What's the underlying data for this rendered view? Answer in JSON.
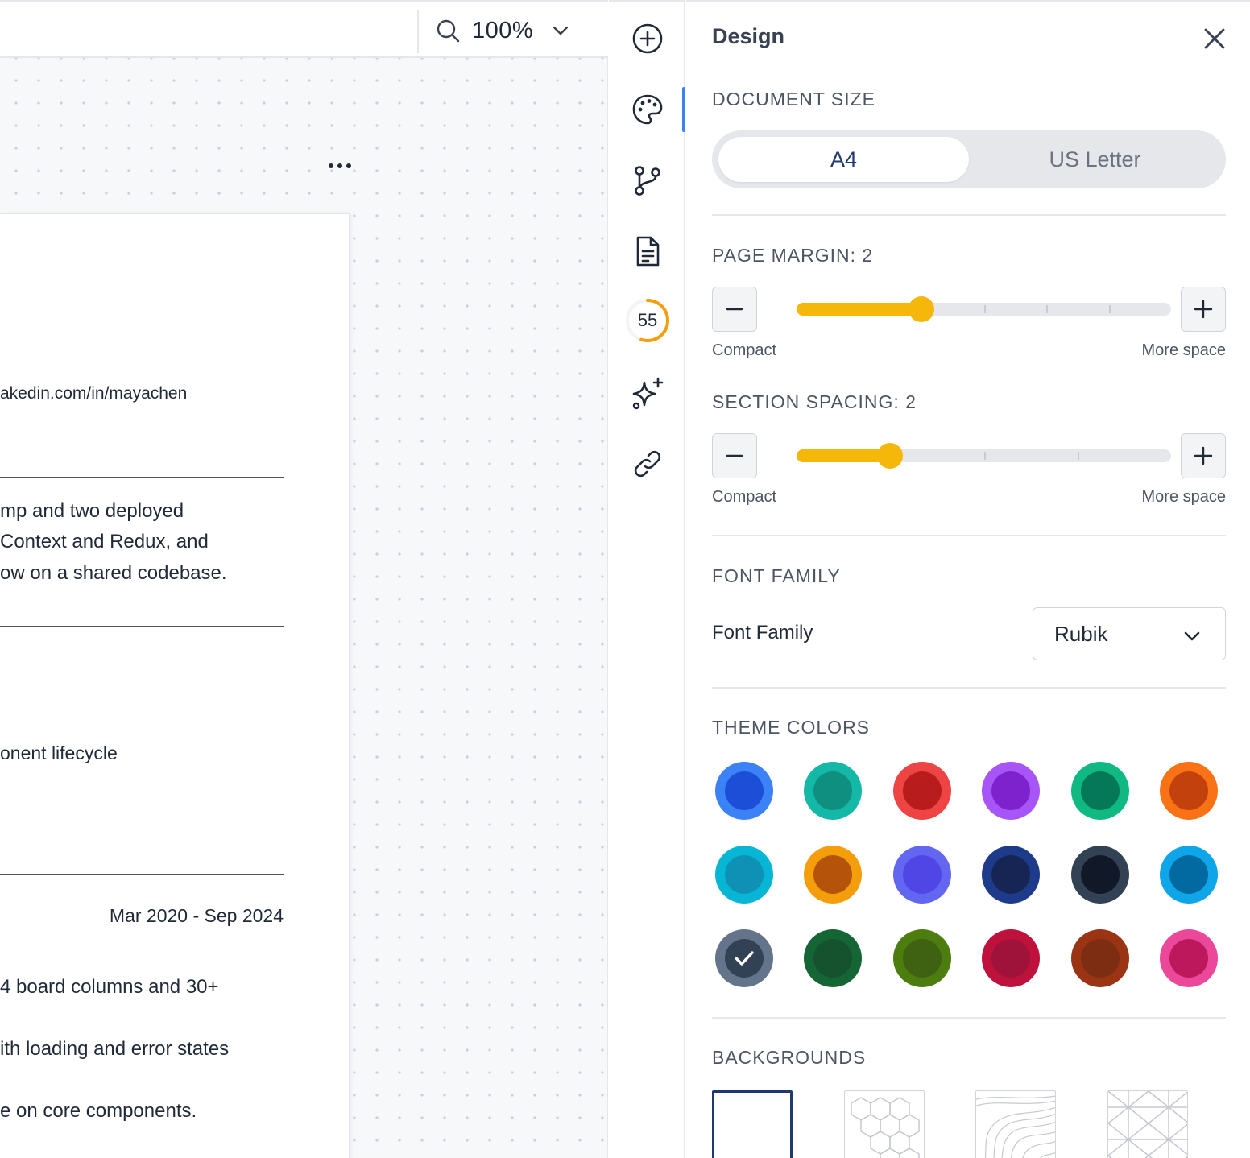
{
  "toolbar": {
    "zoom_value": "100%"
  },
  "document": {
    "linkedin_text": "akedin.com/in/mayachen",
    "summary_lines": [
      "mp and two deployed",
      "Context and Redux, and",
      "ow on a shared codebase."
    ],
    "skill_line": "onent lifecycle",
    "job_dates": "Mar 2020 - Sep 2024",
    "bullets": [
      "4 board columns and 30+",
      "ith loading and error states",
      "e on core components."
    ]
  },
  "rail": {
    "icons": [
      "plus-circle-icon",
      "palette-icon",
      "branch-icon",
      "document-icon",
      "score-icon",
      "sparkle-icon",
      "link-icon"
    ],
    "score": "55",
    "score_percent": 55,
    "score_color": "#f59e0b",
    "active_color": "#3b82f6"
  },
  "panel": {
    "title": "Design",
    "document_size": {
      "label": "DOCUMENT SIZE",
      "options": [
        "A4",
        "US Letter"
      ],
      "selected": "A4"
    },
    "page_margin": {
      "label": "PAGE MARGIN: 2",
      "value": 2,
      "min": 0,
      "max": 6,
      "min_hint": "Compact",
      "max_hint": "More space"
    },
    "section_spacing": {
      "label": "SECTION SPACING: 2",
      "value": 2,
      "min": 1,
      "max": 5,
      "min_hint": "Compact",
      "max_hint": "More space"
    },
    "font_family": {
      "section_label": "FONT FAMILY",
      "field_label": "Font Family",
      "value": "Rubik"
    },
    "theme_colors": {
      "label": "THEME COLORS",
      "selected_index": 12,
      "swatches": [
        {
          "outer": "#3b82f6",
          "inner": "#1d4ed8"
        },
        {
          "outer": "#14b8a6",
          "inner": "#0f8f7f"
        },
        {
          "outer": "#ef4444",
          "inner": "#b91c1c"
        },
        {
          "outer": "#a855f7",
          "inner": "#7e22ce"
        },
        {
          "outer": "#10b981",
          "inner": "#047857"
        },
        {
          "outer": "#f97316",
          "inner": "#c2410c"
        },
        {
          "outer": "#06b6d4",
          "inner": "#0e91b5"
        },
        {
          "outer": "#f59e0b",
          "inner": "#b45309"
        },
        {
          "outer": "#6366f1",
          "inner": "#4f46e5"
        },
        {
          "outer": "#1e3a8a",
          "inner": "#172554"
        },
        {
          "outer": "#334155",
          "inner": "#111827"
        },
        {
          "outer": "#0ea5e9",
          "inner": "#0369a1"
        },
        {
          "outer": "#64748b",
          "inner": "#334155"
        },
        {
          "outer": "#166534",
          "inner": "#14532d"
        },
        {
          "outer": "#4d7c0f",
          "inner": "#3f6212"
        },
        {
          "outer": "#be123c",
          "inner": "#9f1239"
        },
        {
          "outer": "#9a3412",
          "inner": "#7c2d12"
        },
        {
          "outer": "#ec4899",
          "inner": "#be185d"
        }
      ]
    },
    "backgrounds": {
      "label": "BACKGROUNDS",
      "options": [
        "blank",
        "hexagons",
        "topographic",
        "diamond-lattice"
      ],
      "selected": "blank"
    }
  }
}
